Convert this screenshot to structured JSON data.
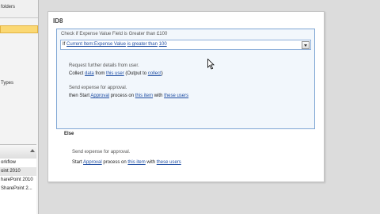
{
  "nav": {
    "top_label": "folders",
    "selected_label": "",
    "types_label": "Types",
    "list_items": [
      "orkflow",
      "oint 2010",
      "harePoint 2010",
      "SharePoint 2..."
    ]
  },
  "step": {
    "title": "ID8",
    "if_block": {
      "comment": "Check if Expense Value Field is Greater than £100",
      "condition": {
        "prefix": "If",
        "field": "Current Item:Expense Value",
        "operator": "is greater than",
        "value": "100"
      },
      "actions": [
        {
          "comment": "Request further details from user.",
          "verb": "Collect",
          "data_link": "data",
          "from_text": "from",
          "user_link": "this user",
          "output_prefix": "(Output to",
          "output_link": "collect",
          "output_suffix": ")"
        },
        {
          "comment": "Send expense for approval.",
          "then_text": "then Start",
          "approval_link": "Approval",
          "process_text": "process on",
          "item_link": "this item",
          "with_text": "with",
          "users_link": "these users"
        }
      ]
    },
    "else_block": {
      "label": "Else",
      "comment": "Send expense for approval.",
      "start_text": "Start",
      "approval_link": "Approval",
      "process_text": "process on",
      "item_link": "this item",
      "with_text": "with",
      "users_link": "these users"
    }
  },
  "colors": {
    "link": "#1f4ea3",
    "condition_border": "#7fa6d4",
    "condition_fill": "#f2f7fc",
    "nav_selected": "#fbd873"
  },
  "icons": {
    "dropdown": "chevron-down-icon",
    "cursor": "mouse-pointer-icon",
    "scroll": "scroll-up-icon"
  }
}
